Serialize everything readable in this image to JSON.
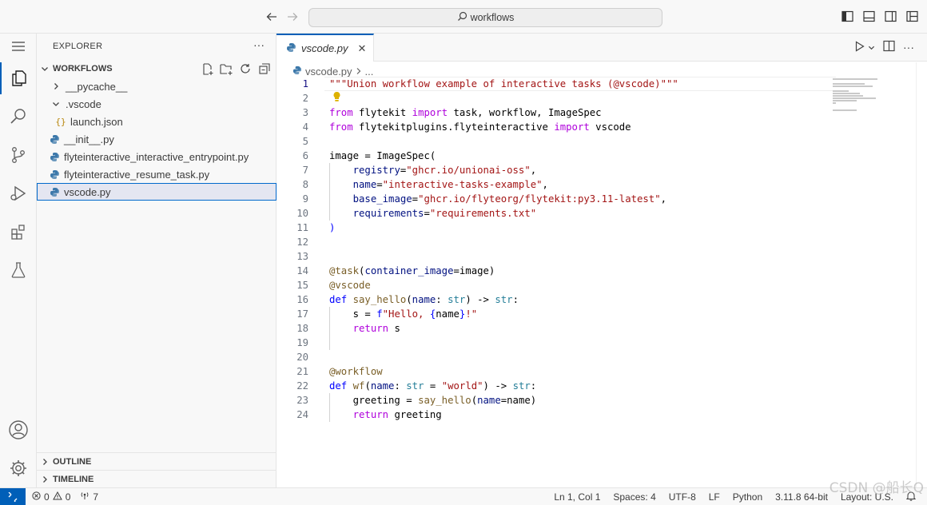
{
  "titlebar": {
    "command_center": "workflows"
  },
  "sidebar": {
    "header": "EXPLORER",
    "more": "···",
    "workspace": "WORKFLOWS",
    "tree": [
      {
        "label": "__pycache__",
        "kind": "folder-collapsed"
      },
      {
        "label": ".vscode",
        "kind": "folder-expanded"
      },
      {
        "label": "launch.json",
        "kind": "json"
      },
      {
        "label": "__init__.py",
        "kind": "python"
      },
      {
        "label": "flyteinteractive_interactive_entrypoint.py",
        "kind": "python"
      },
      {
        "label": "flyteinteractive_resume_task.py",
        "kind": "python"
      },
      {
        "label": "vscode.py",
        "kind": "python",
        "selected": true
      }
    ],
    "outline": "OUTLINE",
    "timeline": "TIMELINE"
  },
  "editor": {
    "tab_label": "vscode.py",
    "breadcrumb_file": "vscode.py",
    "breadcrumb_rest": "...",
    "line_numbers": [
      "1",
      "2",
      "3",
      "4",
      "5",
      "6",
      "7",
      "8",
      "9",
      "10",
      "11",
      "12",
      "13",
      "14",
      "15",
      "16",
      "17",
      "18",
      "19",
      "20",
      "21",
      "22",
      "23",
      "24"
    ]
  },
  "statusbar": {
    "errors": "0",
    "warnings": "0",
    "ports": "7",
    "position": "Ln 1, Col 1",
    "spaces": "Spaces: 4",
    "encoding": "UTF-8",
    "eol": "LF",
    "language": "Python",
    "interpreter": "3.11.8 64-bit",
    "layout": "Layout: U.S."
  },
  "watermark": "CSDN @船长Q",
  "colors": {
    "accent": "#005fb8",
    "keyword": "#af00db",
    "string": "#a31515",
    "decorator": "#795e26"
  }
}
